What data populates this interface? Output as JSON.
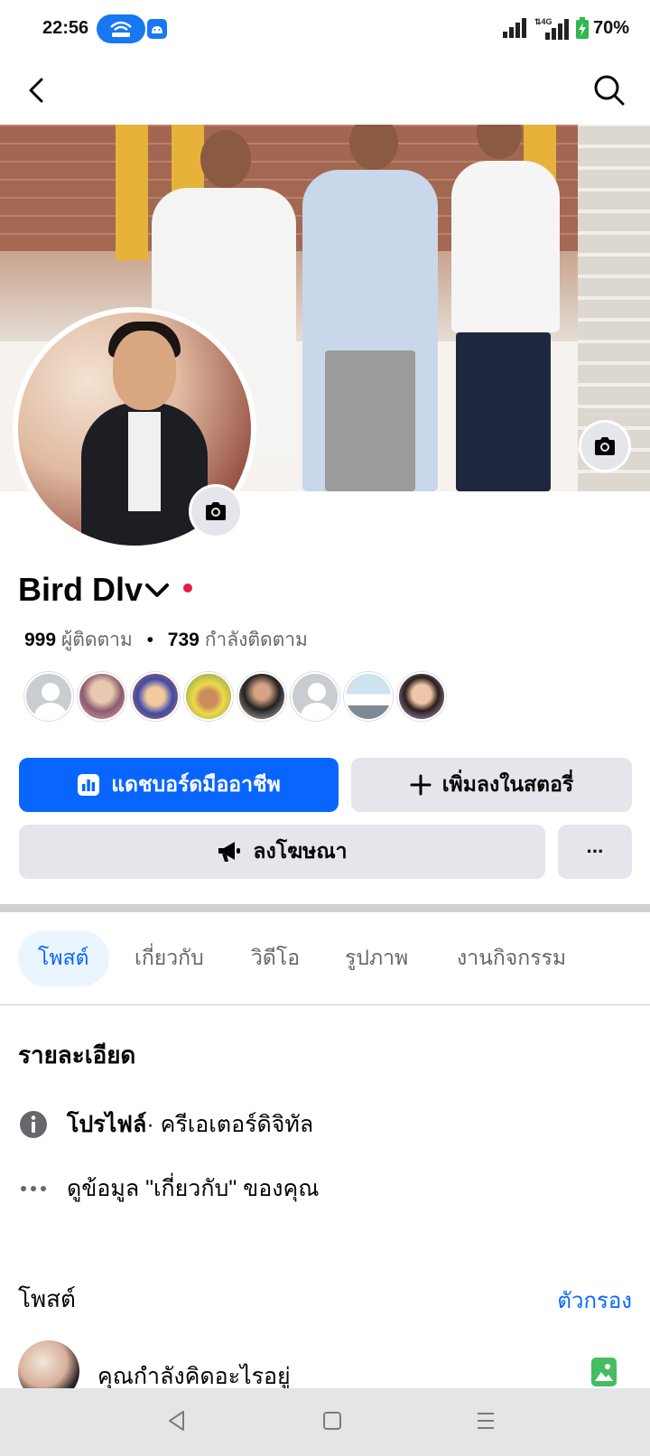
{
  "status_bar": {
    "time": "22:56",
    "network": "4G",
    "battery": "70%",
    "icons": [
      "hotspot-icon",
      "android-icon",
      "signal-icon",
      "signal-4g-icon",
      "battery-charging-icon"
    ]
  },
  "top_nav": {
    "back": "back-arrow-icon",
    "search": "search-icon"
  },
  "profile": {
    "name": "Bird Dlv",
    "followers_count": "999",
    "followers_label": "ผู้ติดตาม",
    "separator": "•",
    "following_count": "739",
    "following_label": "กำลังติดตาม",
    "friend_avatars": 8
  },
  "actions": {
    "dashboard_label": "แดชบอร์ดมืออาชีพ",
    "add_story_label": "เพิ่มลงในสตอรี่",
    "advertise_label": "ลงโฆษณา",
    "more_label": "···"
  },
  "tabs": [
    {
      "label": "โพสต์",
      "active": true
    },
    {
      "label": "เกี่ยวกับ",
      "active": false
    },
    {
      "label": "วิดีโอ",
      "active": false
    },
    {
      "label": "รูปภาพ",
      "active": false
    },
    {
      "label": "งานกิจกรรม",
      "active": false
    }
  ],
  "details": {
    "title": "รายละเอียด",
    "profile_bold": "โปรไฟล์",
    "profile_rest": " · ครีเอเตอร์ดิจิทัล",
    "see_about": "ดูข้อมูล \"เกี่ยวกับ\" ของคุณ"
  },
  "posts": {
    "title": "โพสต์",
    "filter": "ตัวกรอง",
    "composer_placeholder": "คุณกำลังคิดอะไรอยู่"
  },
  "colors": {
    "brand_blue": "#0866ff",
    "secondary_bg": "#e4e6eb",
    "online_dot": "#e41e3f",
    "photo_green": "#45bd62"
  }
}
